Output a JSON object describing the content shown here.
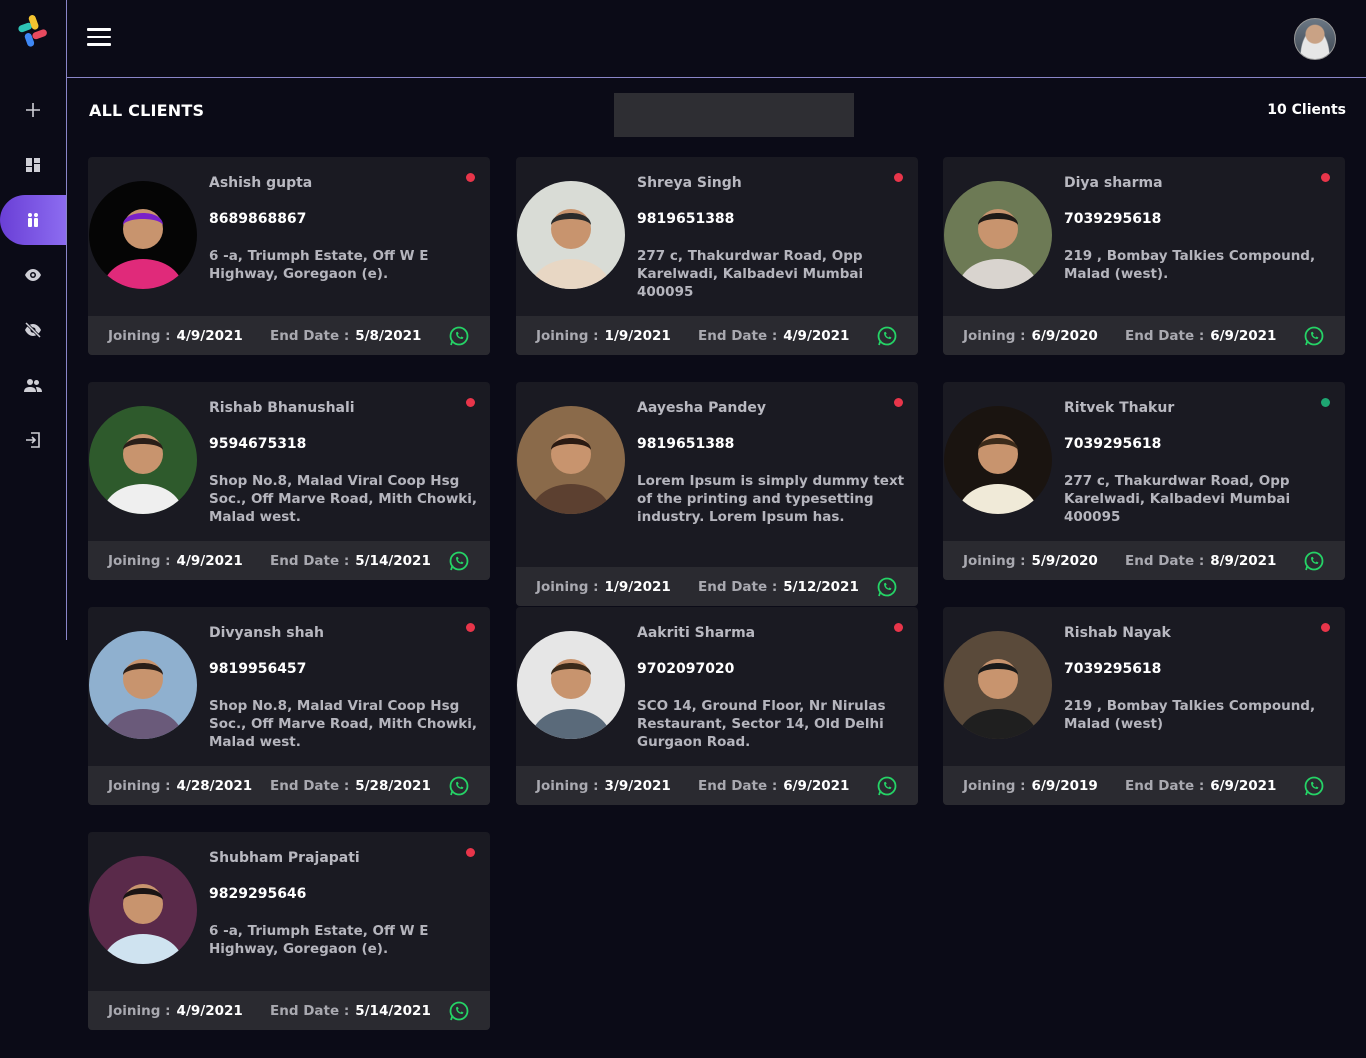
{
  "header": {
    "menu_icon": "hamburger-menu-icon",
    "profile": "user-avatar"
  },
  "sidebar": {
    "items": [
      {
        "icon": "plus-icon",
        "active": false
      },
      {
        "icon": "dashboard-icon",
        "active": false
      },
      {
        "icon": "clients-icon",
        "active": true
      },
      {
        "icon": "eye-icon",
        "active": false
      },
      {
        "icon": "eye-off-icon",
        "active": false
      },
      {
        "icon": "users-icon",
        "active": false
      },
      {
        "icon": "logout-icon",
        "active": false
      }
    ]
  },
  "page": {
    "title": "ALL CLIENTS",
    "search_value": "",
    "count_label": "10 Clients"
  },
  "footer_labels": {
    "joining": "Joining :",
    "end": "End Date :"
  },
  "colors": {
    "accent": "#7a4fe3",
    "status_red": "#e8354a",
    "status_green": "#1ea672",
    "whatsapp": "#25d366"
  },
  "clients": [
    {
      "name": "Ashish gupta",
      "phone": "8689868867",
      "address": "6 -a, Triumph Estate, Off W E Highway, Goregaon (e).",
      "joining": "4/9/2021",
      "end": "5/8/2021",
      "status": "red"
    },
    {
      "name": "Shreya Singh",
      "phone": "9819651388",
      "address": "277 c, Thakurdwar Road, Opp Karelwadi, Kalbadevi Mumbai 400095",
      "joining": "1/9/2021",
      "end": "4/9/2021",
      "status": "red"
    },
    {
      "name": "Diya sharma",
      "phone": "7039295618",
      "address": "219 , Bombay Talkies Compound, Malad (west).",
      "joining": "6/9/2020",
      "end": "6/9/2021",
      "status": "red"
    },
    {
      "name": "Rishab Bhanushali",
      "phone": "9594675318",
      "address": "Shop No.8, Malad Viral Coop Hsg Soc., Off Marve Road, Mith Chowki, Malad west.",
      "joining": "4/9/2021",
      "end": "5/14/2021",
      "status": "red"
    },
    {
      "name": "Aayesha Pandey",
      "phone": "9819651388",
      "address": "Lorem Ipsum is simply dummy text of the printing and typesetting industry. Lorem Ipsum has.",
      "joining": "1/9/2021",
      "end": "5/12/2021",
      "status": "red"
    },
    {
      "name": "Ritvek Thakur",
      "phone": "7039295618",
      "address": "277 c, Thakurdwar Road, Opp Karelwadi, Kalbadevi Mumbai 400095",
      "joining": "5/9/2020",
      "end": "8/9/2021",
      "status": "green"
    },
    {
      "name": "Divyansh shah",
      "phone": "9819956457",
      "address": "Shop No.8, Malad Viral Coop Hsg Soc., Off Marve Road, Mith Chowki, Malad west.",
      "joining": "4/28/2021",
      "end": "5/28/2021",
      "status": "red"
    },
    {
      "name": "Aakriti Sharma",
      "phone": "9702097020",
      "address": "SCO 14, Ground Floor, Nr Nirulas Restaurant, Sector 14, Old Delhi Gurgaon Road.",
      "joining": "3/9/2021",
      "end": "6/9/2021",
      "status": "red"
    },
    {
      "name": "Rishab Nayak",
      "phone": "7039295618",
      "address": "219 , Bombay Talkies Compound, Malad (west)",
      "joining": "6/9/2019",
      "end": "6/9/2021",
      "status": "red"
    },
    {
      "name": "Shubham Prajapati",
      "phone": "9829295646",
      "address": "6 -a, Triumph Estate, Off W E Highway, Goregaon (e).",
      "joining": "4/9/2021",
      "end": "5/14/2021",
      "status": "red"
    }
  ]
}
